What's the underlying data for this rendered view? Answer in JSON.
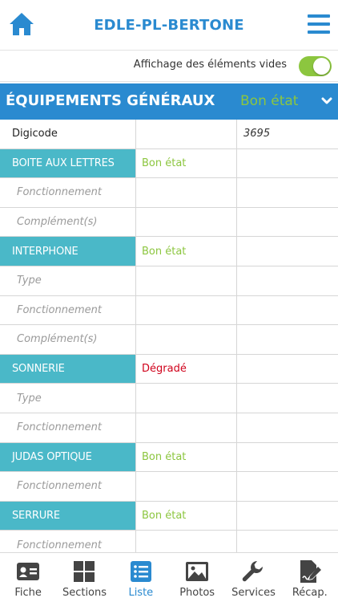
{
  "header": {
    "title": "EDLE-PL-BERTONE"
  },
  "toggle": {
    "label": "Affichage des éléments vides",
    "on": true
  },
  "section": {
    "title": "ÉQUIPEMENTS GÉNÉRAUX",
    "status": "Bon état"
  },
  "colors": {
    "blue": "#2a8ad0",
    "teal": "#4ab8c8",
    "green": "#8cc63f",
    "red": "#d0021b"
  },
  "rows": [
    {
      "type": "plain",
      "label": "Digicode",
      "state": "",
      "value": "3695"
    },
    {
      "type": "head",
      "label": "BOITE AUX LETTRES",
      "state": "Bon état",
      "state_color": "green",
      "value": ""
    },
    {
      "type": "sub",
      "label": "Fonctionnement",
      "state": "",
      "value": ""
    },
    {
      "type": "sub",
      "label": "Complément(s)",
      "state": "",
      "value": ""
    },
    {
      "type": "head",
      "label": "INTERPHONE",
      "state": "Bon état",
      "state_color": "green",
      "value": ""
    },
    {
      "type": "sub",
      "label": "Type",
      "state": "",
      "value": ""
    },
    {
      "type": "sub",
      "label": "Fonctionnement",
      "state": "",
      "value": ""
    },
    {
      "type": "sub",
      "label": "Complément(s)",
      "state": "",
      "value": ""
    },
    {
      "type": "head",
      "label": "SONNERIE",
      "state": "Dégradé",
      "state_color": "red",
      "value": ""
    },
    {
      "type": "sub",
      "label": "Type",
      "state": "",
      "value": ""
    },
    {
      "type": "sub",
      "label": "Fonctionnement",
      "state": "",
      "value": ""
    },
    {
      "type": "head",
      "label": "JUDAS OPTIQUE",
      "state": "Bon état",
      "state_color": "green",
      "value": ""
    },
    {
      "type": "sub",
      "label": "Fonctionnement",
      "state": "",
      "value": ""
    },
    {
      "type": "head",
      "label": "SERRURE",
      "state": "Bon état",
      "state_color": "green",
      "value": ""
    },
    {
      "type": "sub",
      "label": "Fonctionnement",
      "state": "",
      "value": ""
    }
  ],
  "tabs": [
    {
      "label": "Fiche",
      "icon": "id-card-icon",
      "active": false
    },
    {
      "label": "Sections",
      "icon": "grid-icon",
      "active": false
    },
    {
      "label": "Liste",
      "icon": "list-icon",
      "active": true
    },
    {
      "label": "Photos",
      "icon": "image-icon",
      "active": false
    },
    {
      "label": "Services",
      "icon": "wrench-icon",
      "active": false
    },
    {
      "label": "Récap.",
      "icon": "signature-icon",
      "active": false
    }
  ]
}
